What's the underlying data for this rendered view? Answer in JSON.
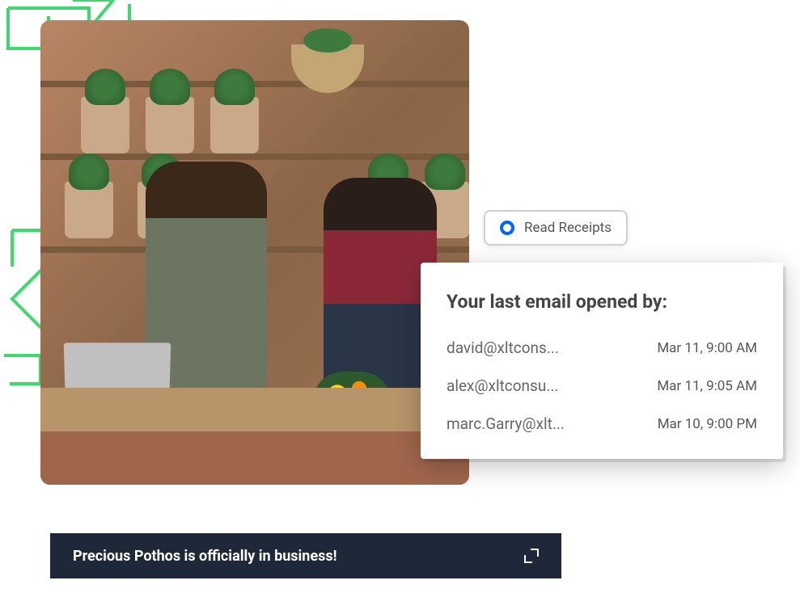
{
  "badge": {
    "label": "Read Receipts"
  },
  "panel": {
    "title": "Your last email opened by:",
    "entries": [
      {
        "email": "david@xltcons...",
        "timestamp": "Mar 11, 9:00 AM"
      },
      {
        "email": "alex@xltconsu...",
        "timestamp": "Mar 11, 9:05 AM"
      },
      {
        "email": "marc.Garry@xlt...",
        "timestamp": "Mar 10, 9:00 PM"
      }
    ]
  },
  "notification": {
    "message": "Precious Pothos is officially in business!"
  }
}
